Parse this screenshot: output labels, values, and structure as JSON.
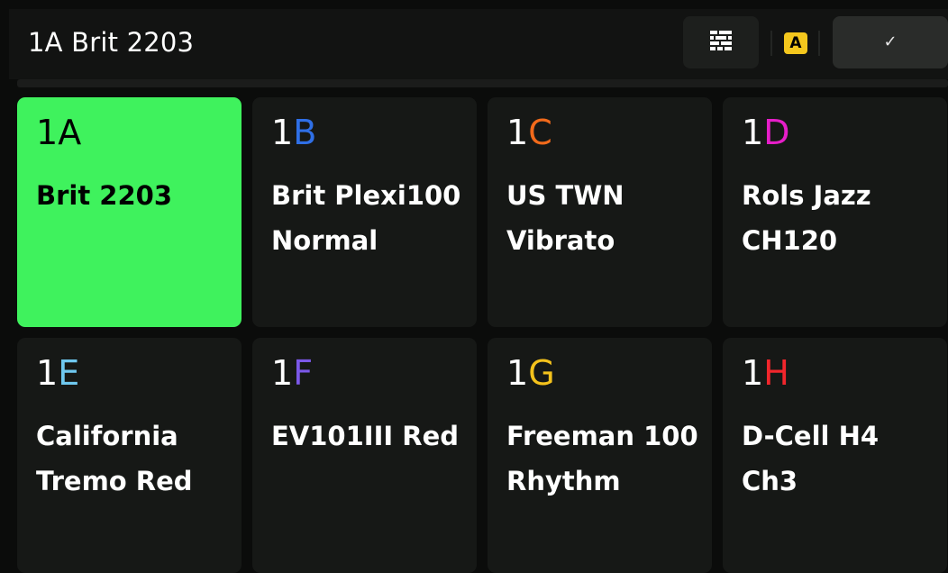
{
  "header": {
    "title": "1A Brit 2203",
    "grid_button_icon": "grid-icon",
    "bank_badge": "A",
    "bank_badge_color": "#f4c71d",
    "confirm_label": "✓"
  },
  "colors": {
    "active_tile": "#3ff25d",
    "tile_bg": "#161816",
    "header_bg": "#121312"
  },
  "presets": [
    {
      "number": "1",
      "letter": "A",
      "name": "Brit 2203",
      "letter_color": "#000000",
      "active": true
    },
    {
      "number": "1",
      "letter": "B",
      "name": "Brit Plexi100 Normal",
      "letter_color": "#2f6fe6",
      "active": false
    },
    {
      "number": "1",
      "letter": "C",
      "name": "US TWN Vibrato",
      "letter_color": "#f26a1b",
      "active": false
    },
    {
      "number": "1",
      "letter": "D",
      "name": "Rols Jazz CH120",
      "letter_color": "#e61ec8",
      "active": false
    },
    {
      "number": "1",
      "letter": "E",
      "name": "California Tremo Red",
      "letter_color": "#6fc8ef",
      "active": false
    },
    {
      "number": "1",
      "letter": "F",
      "name": "EV101III Red",
      "letter_color": "#7b58e8",
      "active": false
    },
    {
      "number": "1",
      "letter": "G",
      "name": "Freeman 100 Rhythm",
      "letter_color": "#f4c21c",
      "active": false
    },
    {
      "number": "1",
      "letter": "H",
      "name": "D-Cell H4 Ch3",
      "letter_color": "#f2262c",
      "active": false
    }
  ]
}
